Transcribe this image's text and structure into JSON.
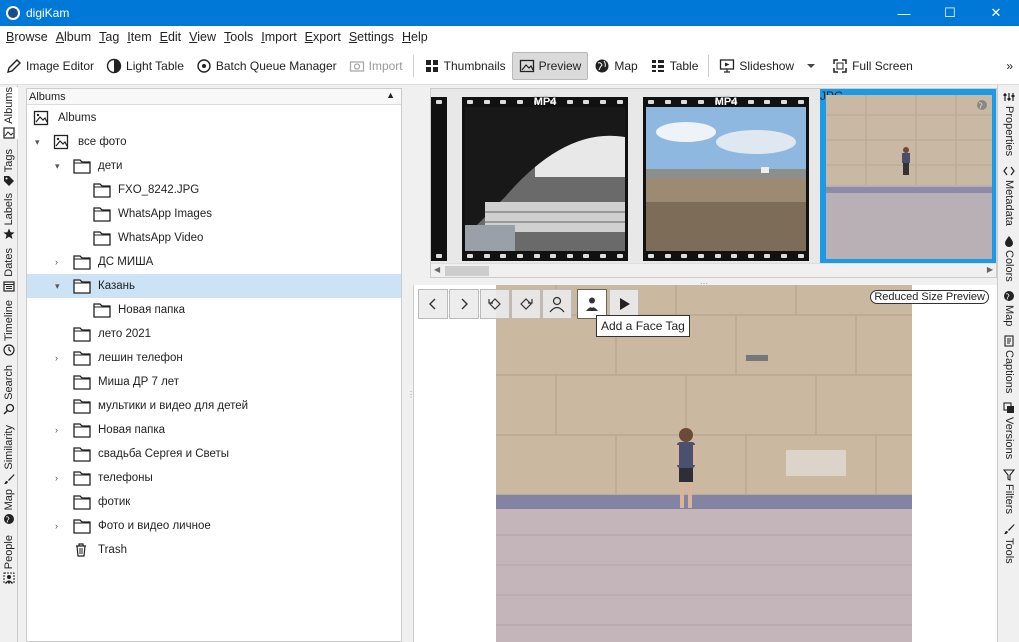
{
  "window": {
    "title": "digiKam",
    "minimize": "—",
    "maximize": "☐",
    "close": "✕"
  },
  "menubar": {
    "items": [
      {
        "first": "B",
        "rest": "rowse"
      },
      {
        "first": "A",
        "rest": "lbum"
      },
      {
        "first": "T",
        "rest": "ag"
      },
      {
        "first": "I",
        "rest": "tem"
      },
      {
        "first": "E",
        "rest": "dit"
      },
      {
        "first": "V",
        "rest": "iew"
      },
      {
        "first": "T",
        "rest": "ools"
      },
      {
        "first": "I",
        "rest": "mport"
      },
      {
        "first": "E",
        "rest": "xport"
      },
      {
        "first": "S",
        "rest": "ettings"
      },
      {
        "first": "H",
        "rest": "elp"
      }
    ]
  },
  "toolbar": {
    "image_editor": "Image Editor",
    "light_table": "Light Table",
    "batch_queue": "Batch Queue Manager",
    "import": "Import",
    "thumbnails": "Thumbnails",
    "preview": "Preview",
    "map": "Map",
    "table": "Table",
    "slideshow": "Slideshow",
    "full_screen": "Full Screen",
    "overflow": "»"
  },
  "left_tabs": [
    "Albums",
    "Tags",
    "Labels",
    "Dates",
    "Timeline",
    "Search",
    "Similarity",
    "Map",
    "People"
  ],
  "right_tabs": [
    "Properties",
    "Metadata",
    "Colors",
    "Map",
    "Captions",
    "Versions",
    "Filters",
    "Tools"
  ],
  "albums": {
    "header": "Albums",
    "rows": [
      {
        "label": "Albums",
        "level": 0,
        "arrow": "",
        "icon": "album-root"
      },
      {
        "label": "все фото",
        "level": 1,
        "arrow": "▾",
        "icon": "album-root"
      },
      {
        "label": "дети",
        "level": 2,
        "arrow": "▾",
        "icon": "folder"
      },
      {
        "label": "FXO_8242.JPG",
        "level": 3,
        "arrow": "",
        "icon": "folder"
      },
      {
        "label": "WhatsApp Images",
        "level": 3,
        "arrow": "",
        "icon": "folder"
      },
      {
        "label": "WhatsApp Video",
        "level": 3,
        "arrow": "",
        "icon": "folder"
      },
      {
        "label": "ДС МИША",
        "level": 2,
        "arrow": "›",
        "icon": "folder"
      },
      {
        "label": "Казань",
        "level": 2,
        "arrow": "▾",
        "icon": "folder",
        "selected": true
      },
      {
        "label": "Новая папка",
        "level": 3,
        "arrow": "",
        "icon": "folder"
      },
      {
        "label": "лето 2021",
        "level": 2,
        "arrow": "",
        "icon": "folder"
      },
      {
        "label": "лешин телефон",
        "level": 2,
        "arrow": "›",
        "icon": "folder"
      },
      {
        "label": "Миша ДР 7 лет",
        "level": 2,
        "arrow": "",
        "icon": "folder"
      },
      {
        "label": "мультики и видео для детей",
        "level": 2,
        "arrow": "",
        "icon": "folder"
      },
      {
        "label": "Новая папка",
        "level": 2,
        "arrow": "›",
        "icon": "folder"
      },
      {
        "label": "свадьба Сергея и Светы",
        "level": 2,
        "arrow": "",
        "icon": "folder"
      },
      {
        "label": "телефоны",
        "level": 2,
        "arrow": "›",
        "icon": "folder"
      },
      {
        "label": "фотик",
        "level": 2,
        "arrow": "",
        "icon": "folder"
      },
      {
        "label": "Фото и видео личное",
        "level": 2,
        "arrow": "›",
        "icon": "folder"
      },
      {
        "label": "Trash",
        "level": 2,
        "arrow": "",
        "icon": "trash"
      }
    ]
  },
  "thumbnails": [
    {
      "format": "MP4"
    },
    {
      "format": "MP4"
    },
    {
      "format": "JPG"
    }
  ],
  "preview": {
    "tooltip": "Add a Face Tag",
    "badge": "Reduced Size Preview"
  },
  "colors": {
    "accent": "#0078d7",
    "selection": "#cce3f6",
    "thumb_selected": "#1b9be6"
  }
}
